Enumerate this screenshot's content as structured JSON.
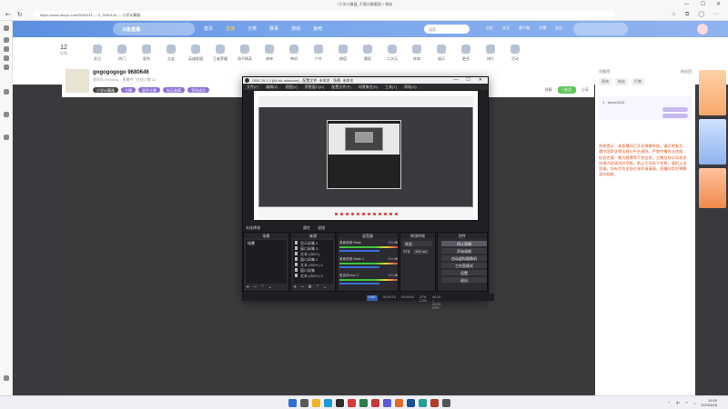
{
  "browser": {
    "window_title": "（小学计算器_不要对着截图 + 晚安",
    "url": "https://www.douyu.com/9000441 — 0_9000144 — 小学计算器",
    "back": "←",
    "refresh": "↻",
    "window_min": "—",
    "window_max": "☐",
    "window_close": "✕"
  },
  "site": {
    "logo_text": "斗鱼直播",
    "nav_links": [
      "首页",
      "直播",
      "分类",
      "赛事",
      "游戏",
      "鱼吧"
    ],
    "active_nav_index": 1,
    "search_placeholder": "搜索",
    "right_links": [
      "历史",
      "关注",
      "客户端",
      "开播",
      "会员"
    ],
    "live_count": "12",
    "live_count_label": "在线",
    "categories": [
      "关注",
      "热门",
      "星秀",
      "交友",
      "英雄联盟",
      "王者荣耀",
      "和平精英",
      "原神",
      "单机",
      "户外",
      "颜值",
      "舞蹈",
      "二次元",
      "体育",
      "娱乐",
      "更多",
      "排行",
      "活动"
    ],
    "streamer": {
      "name": "gogogogogo 9680646",
      "meta": "房间号 9000441 · 直播中 · 在线人数 12",
      "tags": [
        "小学计算器",
        "主播",
        "星秀主播",
        "钻石勋章",
        "签到成功"
      ],
      "rating_label": "弹幕",
      "follow_label": "+关注",
      "share_label": "分享"
    },
    "chat": {
      "tab_rank": "贡献榜",
      "tab_fans": "粉丝团",
      "btns": [
        "贵宾",
        "粉丝",
        "打赏"
      ],
      "rank_user": "1 ·  lanze2023",
      "notice": "系统提示：本直播间已开启弹幕审核。请文明发言，遵守国家法律法规与平台规则。严禁传播违法违规、低俗色情、暴力赌博等不良信息。主播及观众如发现违规内容请及时举报。禁止引导私下交易，谨防上当受骗，如有涉及金钱往来的请谨慎。直播间实时弹幕请勿刷屏。"
    }
  },
  "obs": {
    "title": "OBS 29.1.3 (64 bit, windows) - 配置文件: 未命名 - 场景: 未命名",
    "menu": [
      "文件(F)",
      "编辑(E)",
      "视图(V)",
      "停靠窗口(D)",
      "配置文件(P)",
      "场景集合(S)",
      "工具(T)",
      "帮助(H)"
    ],
    "source_bar_label": "未选择源",
    "source_bar_props": "属性",
    "source_bar_filters": "滤镜",
    "docks": {
      "scenes": "场景",
      "sources": "来源",
      "mixer": "混音器",
      "transitions": "转场特效",
      "controls": "控件"
    },
    "scene_items": [
      "场景"
    ],
    "source_items": [
      "显示采集 2",
      "窗口采集 3",
      "文本 (GDI+)",
      "窗口采集 2",
      "文本 (GDI+) 2",
      "窗口采集",
      "文本 (GDI+) 3"
    ],
    "mixer_items": [
      {
        "name": "桌面音频 Mask",
        "level": "0.0 dB"
      },
      {
        "name": "桌面音频 Mask 2",
        "level": "0.0 dB"
      },
      {
        "name": "麦克风/Aux 2",
        "level": "0.0 dB"
      }
    ],
    "transition_value": "渐变",
    "duration_label": "时长",
    "duration_value": "300 ms",
    "controls": [
      "停止直播",
      "开始录制",
      "启动虚拟摄像机",
      "工作室模式",
      "设置",
      "退出"
    ],
    "status": {
      "live_badge": "LIVE",
      "live_time": "00:00:10",
      "rec_time": "00:00:00",
      "cpu": "CPU: 2.3%",
      "fps": "60.00 / 60.00 FPS"
    }
  },
  "taskbar": {
    "time": "19:30",
    "date": "2023/8/18",
    "lang": "中"
  },
  "colors": {
    "site_nav": "#5b8fe0",
    "accent_purple": "#8b6ed8",
    "notice_orange": "#e25b2c",
    "obs_bg": "#202024"
  }
}
